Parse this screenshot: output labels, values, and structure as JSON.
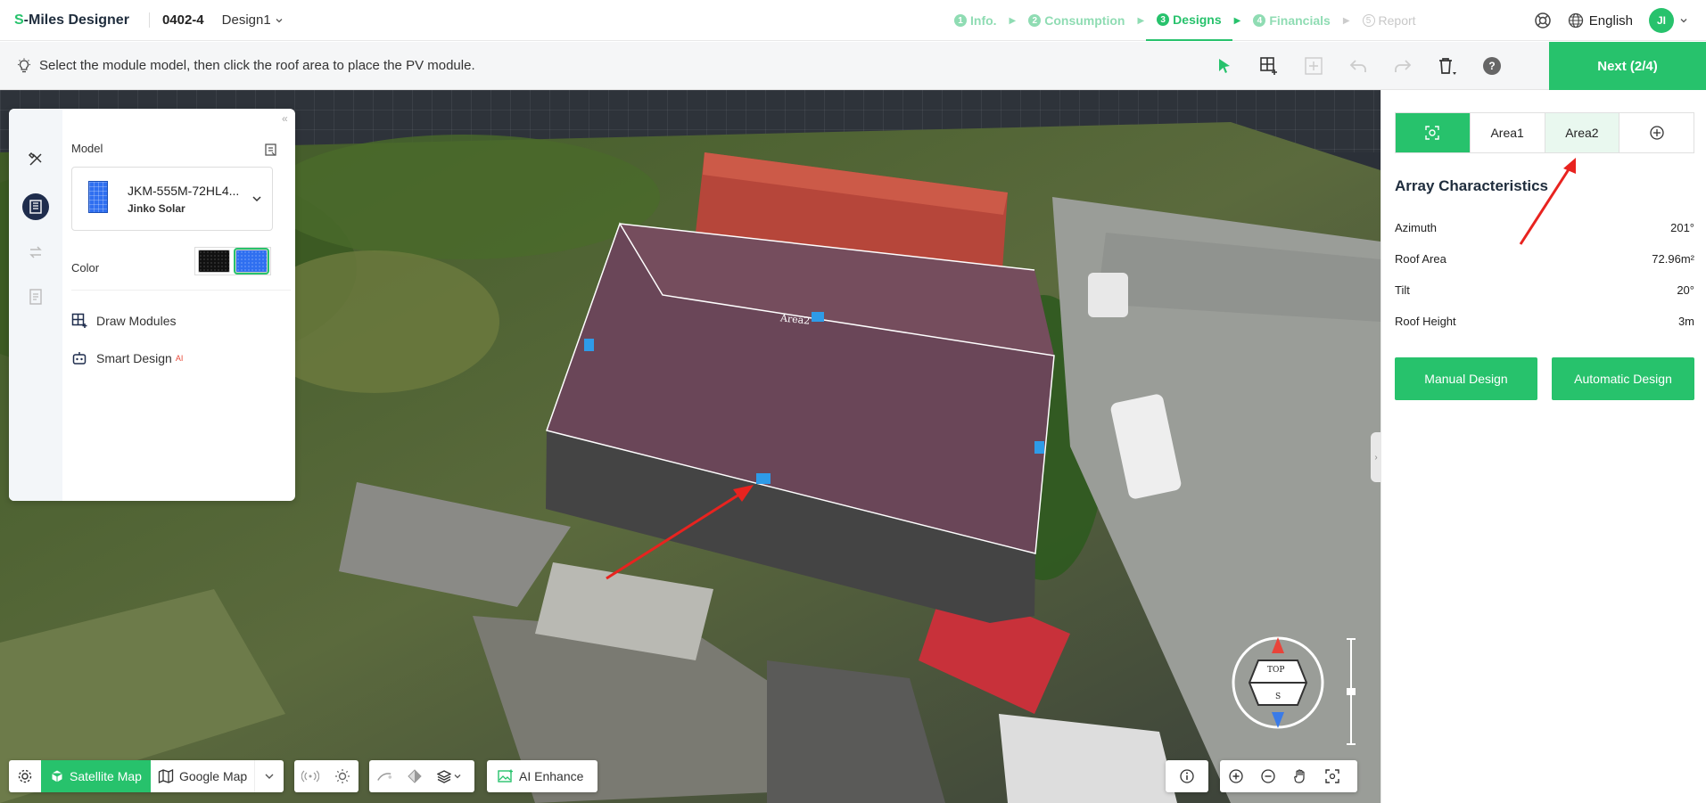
{
  "app": {
    "brand_prefix": "S",
    "brand_rest": "-Miles Designer",
    "project_id": "0402-4",
    "design_name": "Design1"
  },
  "steps": [
    {
      "num": "1",
      "label": "Info."
    },
    {
      "num": "2",
      "label": "Consumption"
    },
    {
      "num": "3",
      "label": "Designs"
    },
    {
      "num": "4",
      "label": "Financials"
    },
    {
      "num": "5",
      "label": "Report"
    }
  ],
  "top_right": {
    "language": "English",
    "avatar_initials": "JI"
  },
  "toolbar": {
    "hint": "Select the module model, then click the roof area to place the PV module.",
    "help": "?",
    "next_label": "Next (2/4)"
  },
  "left_panel": {
    "model_label": "Model",
    "model_name": "JKM-555M-72HL4...",
    "model_brand": "Jinko Solar",
    "color_label": "Color",
    "draw_modules": "Draw Modules",
    "smart_design": "Smart Design",
    "smart_badge": "AI"
  },
  "right_panel": {
    "tabs": [
      "Area1",
      "Area2"
    ],
    "title": "Array Characteristics",
    "rows": [
      {
        "label": "Azimuth",
        "value": "201°"
      },
      {
        "label": "Roof Area",
        "value": "72.96m²"
      },
      {
        "label": "Tilt",
        "value": "20°"
      },
      {
        "label": "Roof Height",
        "value": "3m"
      }
    ],
    "manual_btn": "Manual Design",
    "auto_btn": "Automatic Design"
  },
  "scene": {
    "area_label": "Area2",
    "compass_top": "TOP",
    "compass_bottom": "S"
  },
  "bottom": {
    "satellite": "Satellite Map",
    "google": "Google Map",
    "ai_enhance": "AI Enhance"
  },
  "colors": {
    "accent": "#27c26c",
    "module_blue": "#2f6ff0",
    "arrow": "#e8231f"
  }
}
